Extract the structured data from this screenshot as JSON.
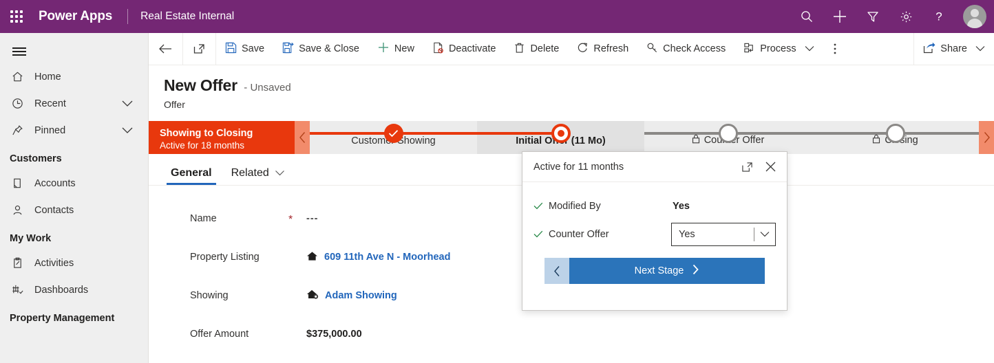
{
  "topbar": {
    "waffle_label": "App launcher",
    "brand": "Power Apps",
    "app_name": "Real Estate Internal",
    "icons": [
      {
        "name": "search-icon",
        "label": "Search"
      },
      {
        "name": "plus-icon",
        "label": "New"
      },
      {
        "name": "filter-icon",
        "label": "Filter"
      },
      {
        "name": "gear-icon",
        "label": "Settings"
      },
      {
        "name": "help-icon",
        "label": "Help"
      }
    ],
    "purple": "#742774"
  },
  "sidebar": {
    "hamburger_label": "Expand/collapse site map",
    "items": [
      {
        "label": "Home",
        "icon": "home-icon",
        "chevron": false
      },
      {
        "label": "Recent",
        "icon": "clock-icon",
        "chevron": true
      },
      {
        "label": "Pinned",
        "icon": "pin-icon",
        "chevron": true
      }
    ],
    "groups": [
      {
        "title": "Customers",
        "items": [
          {
            "label": "Accounts",
            "icon": "accounts-icon"
          },
          {
            "label": "Contacts",
            "icon": "contact-icon"
          }
        ]
      },
      {
        "title": "My Work",
        "items": [
          {
            "label": "Activities",
            "icon": "activities-icon"
          },
          {
            "label": "Dashboards",
            "icon": "dashboards-icon"
          }
        ]
      },
      {
        "title": "Property Management",
        "items": []
      }
    ]
  },
  "commandbar": {
    "back_label": "Back",
    "popout_label": "Open in new window",
    "buttons": [
      {
        "label": "Save",
        "icon": "save-icon"
      },
      {
        "label": "Save & Close",
        "icon": "save-close-icon"
      },
      {
        "label": "New",
        "icon": "plus-icon"
      },
      {
        "label": "Deactivate",
        "icon": "deactivate-icon"
      },
      {
        "label": "Delete",
        "icon": "trash-icon"
      },
      {
        "label": "Refresh",
        "icon": "refresh-icon"
      },
      {
        "label": "Check Access",
        "icon": "key-icon"
      },
      {
        "label": "Process",
        "icon": "process-icon",
        "chevron": true
      }
    ],
    "overflow_label": "More commands",
    "share_label": "Share"
  },
  "record": {
    "title": "New Offer",
    "unsaved": "- Unsaved",
    "entity": "Offer"
  },
  "bpf": {
    "name": "Showing to Closing",
    "duration": "Active for 18 months",
    "prev_label": "Previous stage",
    "next_label": "Next stage",
    "active_color": "#e8380d",
    "stages": [
      {
        "label": "Customer Showing",
        "state": "done",
        "locked": false
      },
      {
        "label": "Initial Offer  (11 Mo)",
        "state": "active",
        "locked": false
      },
      {
        "label": "Counter Offer",
        "state": "future",
        "locked": true
      },
      {
        "label": "Closing",
        "state": "future",
        "locked": true
      }
    ]
  },
  "flyout": {
    "header": "Active for 11 months",
    "popout_label": "Open stage in new window",
    "close_label": "Close",
    "fields": [
      {
        "label": "Modified By",
        "type": "text",
        "value": "Yes"
      },
      {
        "label": "Counter Offer",
        "type": "select",
        "value": "Yes"
      }
    ],
    "back_label": "Previous stage",
    "next_stage_label": "Next Stage"
  },
  "tabs": [
    {
      "label": "General",
      "active": true,
      "chevron": false
    },
    {
      "label": "Related",
      "active": false,
      "chevron": true
    }
  ],
  "form": {
    "rows": [
      {
        "label": "Name",
        "required": true,
        "value": "---",
        "kind": "dashes",
        "icon": null
      },
      {
        "label": "Property Listing",
        "required": false,
        "value": "609 11th Ave N - Moorhead",
        "kind": "link",
        "icon": "house-icon"
      },
      {
        "label": "Showing",
        "required": false,
        "value": "Adam Showing",
        "kind": "link",
        "icon": "showing-icon"
      },
      {
        "label": "Offer Amount",
        "required": false,
        "value": "$375,000.00",
        "kind": "bold",
        "icon": null
      }
    ]
  }
}
